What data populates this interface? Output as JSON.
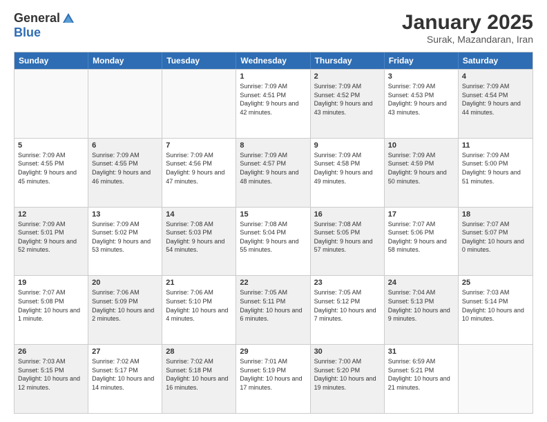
{
  "header": {
    "logo_general": "General",
    "logo_blue": "Blue",
    "month_title": "January 2025",
    "location": "Surak, Mazandaran, Iran"
  },
  "weekdays": [
    "Sunday",
    "Monday",
    "Tuesday",
    "Wednesday",
    "Thursday",
    "Friday",
    "Saturday"
  ],
  "rows": [
    [
      {
        "day": "",
        "text": "",
        "shaded": false,
        "empty": true
      },
      {
        "day": "",
        "text": "",
        "shaded": false,
        "empty": true
      },
      {
        "day": "",
        "text": "",
        "shaded": false,
        "empty": true
      },
      {
        "day": "1",
        "text": "Sunrise: 7:09 AM\nSunset: 4:51 PM\nDaylight: 9 hours and 42 minutes.",
        "shaded": false,
        "empty": false
      },
      {
        "day": "2",
        "text": "Sunrise: 7:09 AM\nSunset: 4:52 PM\nDaylight: 9 hours and 43 minutes.",
        "shaded": true,
        "empty": false
      },
      {
        "day": "3",
        "text": "Sunrise: 7:09 AM\nSunset: 4:53 PM\nDaylight: 9 hours and 43 minutes.",
        "shaded": false,
        "empty": false
      },
      {
        "day": "4",
        "text": "Sunrise: 7:09 AM\nSunset: 4:54 PM\nDaylight: 9 hours and 44 minutes.",
        "shaded": true,
        "empty": false
      }
    ],
    [
      {
        "day": "5",
        "text": "Sunrise: 7:09 AM\nSunset: 4:55 PM\nDaylight: 9 hours and 45 minutes.",
        "shaded": false,
        "empty": false
      },
      {
        "day": "6",
        "text": "Sunrise: 7:09 AM\nSunset: 4:55 PM\nDaylight: 9 hours and 46 minutes.",
        "shaded": true,
        "empty": false
      },
      {
        "day": "7",
        "text": "Sunrise: 7:09 AM\nSunset: 4:56 PM\nDaylight: 9 hours and 47 minutes.",
        "shaded": false,
        "empty": false
      },
      {
        "day": "8",
        "text": "Sunrise: 7:09 AM\nSunset: 4:57 PM\nDaylight: 9 hours and 48 minutes.",
        "shaded": true,
        "empty": false
      },
      {
        "day": "9",
        "text": "Sunrise: 7:09 AM\nSunset: 4:58 PM\nDaylight: 9 hours and 49 minutes.",
        "shaded": false,
        "empty": false
      },
      {
        "day": "10",
        "text": "Sunrise: 7:09 AM\nSunset: 4:59 PM\nDaylight: 9 hours and 50 minutes.",
        "shaded": true,
        "empty": false
      },
      {
        "day": "11",
        "text": "Sunrise: 7:09 AM\nSunset: 5:00 PM\nDaylight: 9 hours and 51 minutes.",
        "shaded": false,
        "empty": false
      }
    ],
    [
      {
        "day": "12",
        "text": "Sunrise: 7:09 AM\nSunset: 5:01 PM\nDaylight: 9 hours and 52 minutes.",
        "shaded": true,
        "empty": false
      },
      {
        "day": "13",
        "text": "Sunrise: 7:09 AM\nSunset: 5:02 PM\nDaylight: 9 hours and 53 minutes.",
        "shaded": false,
        "empty": false
      },
      {
        "day": "14",
        "text": "Sunrise: 7:08 AM\nSunset: 5:03 PM\nDaylight: 9 hours and 54 minutes.",
        "shaded": true,
        "empty": false
      },
      {
        "day": "15",
        "text": "Sunrise: 7:08 AM\nSunset: 5:04 PM\nDaylight: 9 hours and 55 minutes.",
        "shaded": false,
        "empty": false
      },
      {
        "day": "16",
        "text": "Sunrise: 7:08 AM\nSunset: 5:05 PM\nDaylight: 9 hours and 57 minutes.",
        "shaded": true,
        "empty": false
      },
      {
        "day": "17",
        "text": "Sunrise: 7:07 AM\nSunset: 5:06 PM\nDaylight: 9 hours and 58 minutes.",
        "shaded": false,
        "empty": false
      },
      {
        "day": "18",
        "text": "Sunrise: 7:07 AM\nSunset: 5:07 PM\nDaylight: 10 hours and 0 minutes.",
        "shaded": true,
        "empty": false
      }
    ],
    [
      {
        "day": "19",
        "text": "Sunrise: 7:07 AM\nSunset: 5:08 PM\nDaylight: 10 hours and 1 minute.",
        "shaded": false,
        "empty": false
      },
      {
        "day": "20",
        "text": "Sunrise: 7:06 AM\nSunset: 5:09 PM\nDaylight: 10 hours and 2 minutes.",
        "shaded": true,
        "empty": false
      },
      {
        "day": "21",
        "text": "Sunrise: 7:06 AM\nSunset: 5:10 PM\nDaylight: 10 hours and 4 minutes.",
        "shaded": false,
        "empty": false
      },
      {
        "day": "22",
        "text": "Sunrise: 7:05 AM\nSunset: 5:11 PM\nDaylight: 10 hours and 6 minutes.",
        "shaded": true,
        "empty": false
      },
      {
        "day": "23",
        "text": "Sunrise: 7:05 AM\nSunset: 5:12 PM\nDaylight: 10 hours and 7 minutes.",
        "shaded": false,
        "empty": false
      },
      {
        "day": "24",
        "text": "Sunrise: 7:04 AM\nSunset: 5:13 PM\nDaylight: 10 hours and 9 minutes.",
        "shaded": true,
        "empty": false
      },
      {
        "day": "25",
        "text": "Sunrise: 7:03 AM\nSunset: 5:14 PM\nDaylight: 10 hours and 10 minutes.",
        "shaded": false,
        "empty": false
      }
    ],
    [
      {
        "day": "26",
        "text": "Sunrise: 7:03 AM\nSunset: 5:15 PM\nDaylight: 10 hours and 12 minutes.",
        "shaded": true,
        "empty": false
      },
      {
        "day": "27",
        "text": "Sunrise: 7:02 AM\nSunset: 5:17 PM\nDaylight: 10 hours and 14 minutes.",
        "shaded": false,
        "empty": false
      },
      {
        "day": "28",
        "text": "Sunrise: 7:02 AM\nSunset: 5:18 PM\nDaylight: 10 hours and 16 minutes.",
        "shaded": true,
        "empty": false
      },
      {
        "day": "29",
        "text": "Sunrise: 7:01 AM\nSunset: 5:19 PM\nDaylight: 10 hours and 17 minutes.",
        "shaded": false,
        "empty": false
      },
      {
        "day": "30",
        "text": "Sunrise: 7:00 AM\nSunset: 5:20 PM\nDaylight: 10 hours and 19 minutes.",
        "shaded": true,
        "empty": false
      },
      {
        "day": "31",
        "text": "Sunrise: 6:59 AM\nSunset: 5:21 PM\nDaylight: 10 hours and 21 minutes.",
        "shaded": false,
        "empty": false
      },
      {
        "day": "",
        "text": "",
        "shaded": false,
        "empty": true
      }
    ]
  ]
}
